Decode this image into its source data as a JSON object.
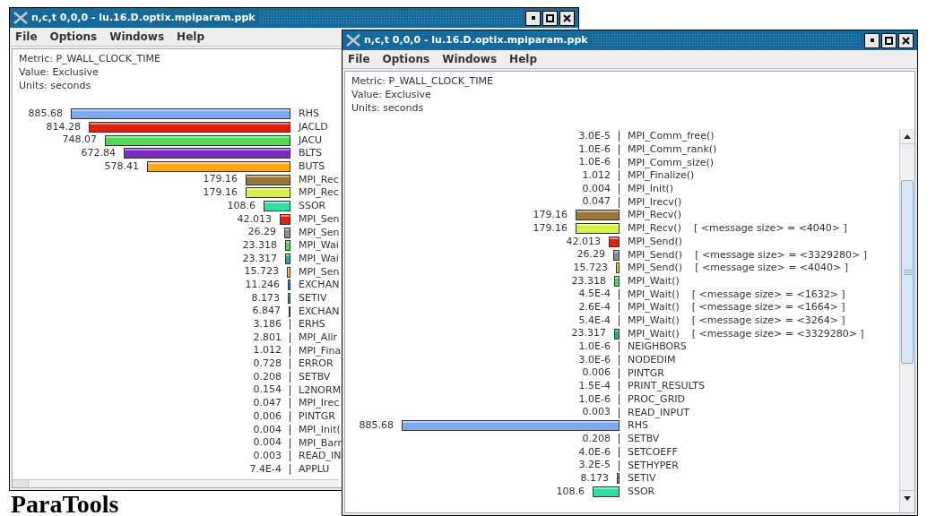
{
  "windows": [
    {
      "title": "n,c,t 0,0,0 - lu.16.D.optix.mpiparam.ppk",
      "menu": [
        "File",
        "Options",
        "Windows",
        "Help"
      ],
      "info": [
        "Metric: P_WALL_CLOCK_TIME",
        "Value: Exclusive",
        "Units: seconds"
      ],
      "rows": [
        {
          "value": "885.68",
          "label": "RHS",
          "color": "#7faaf2"
        },
        {
          "value": "814.28",
          "label": "JACLD",
          "color": "#e0200c"
        },
        {
          "value": "748.07",
          "label": "JACU",
          "color": "#52d852"
        },
        {
          "value": "672.84",
          "label": "BLTS",
          "color": "#7a2cc0"
        },
        {
          "value": "578.41",
          "label": "BUTS",
          "color": "#ffa812"
        },
        {
          "value": "179.16",
          "label": "MPI_Rec",
          "color": "#9a7638"
        },
        {
          "value": "179.16",
          "label": "MPI_Rec",
          "color": "#d6f248"
        },
        {
          "value": "108.6",
          "label": "SSOR",
          "color": "#2ee0a4"
        },
        {
          "value": "42.013",
          "label": "MPI_Sen",
          "color": "#e0200c"
        },
        {
          "value": "26.29",
          "label": "MPI_Sen",
          "color": "#8c8c8c"
        },
        {
          "value": "23.318",
          "label": "MPI_Wai",
          "color": "#52d852"
        },
        {
          "value": "23.317",
          "label": "MPI_Wai",
          "color": "#1fae96"
        },
        {
          "value": "15.723",
          "label": "MPI_Sen",
          "color": "#f2c21e"
        },
        {
          "value": "11.246",
          "label": "EXCHAN",
          "color": "#1f86e0"
        },
        {
          "value": "8.173",
          "label": "SETIV",
          "color": "#5e9e62"
        },
        {
          "value": "6.847",
          "label": "EXCHAN"
        },
        {
          "value": "3.186",
          "label": "ERHS"
        },
        {
          "value": "2.801",
          "label": "MPI_Allr"
        },
        {
          "value": "1.012",
          "label": "MPI_Fina"
        },
        {
          "value": "0.728",
          "label": "ERROR"
        },
        {
          "value": "0.208",
          "label": "SETBV"
        },
        {
          "value": "0.154",
          "label": "L2NORM"
        },
        {
          "value": "0.047",
          "label": "MPI_Irec"
        },
        {
          "value": "0.006",
          "label": "PINTGR"
        },
        {
          "value": "0.004",
          "label": "MPI_Init("
        },
        {
          "value": "0.004",
          "label": "MPI_Barr"
        },
        {
          "value": "0.003",
          "label": "READ_IN"
        },
        {
          "value": "7.4E-4",
          "label": "APPLU"
        }
      ]
    },
    {
      "title": "n,c,t 0,0,0 - lu.16.D.optix.mpiparam.ppk",
      "menu": [
        "File",
        "Options",
        "Windows",
        "Help"
      ],
      "info": [
        "Metric: P_WALL_CLOCK_TIME",
        "Value: Exclusive",
        "Units: seconds"
      ],
      "rows": [
        {
          "value": "3.0E-5",
          "label": "MPI_Comm_free()"
        },
        {
          "value": "1.0E-6",
          "label": "MPI_Comm_rank()"
        },
        {
          "value": "1.0E-6",
          "label": "MPI_Comm_size()"
        },
        {
          "value": "1.012",
          "label": "MPI_Finalize()"
        },
        {
          "value": "0.004",
          "label": "MPI_Init()"
        },
        {
          "value": "0.047",
          "label": "MPI_Irecv()"
        },
        {
          "value": "179.16",
          "label": "MPI_Recv()",
          "color": "#9a7638"
        },
        {
          "value": "179.16",
          "label": "MPI_Recv()",
          "detail": "[ <message size> = <4040> ]",
          "color": "#d6f248"
        },
        {
          "value": "42.013",
          "label": "MPI_Send()",
          "color": "#e0200c"
        },
        {
          "value": "26.29",
          "label": "MPI_Send()",
          "detail": "[ <message size> = <3329280> ]",
          "color": "#8c8c8c"
        },
        {
          "value": "15.723",
          "label": "MPI_Send()",
          "detail": "[ <message size> = <4040> ]",
          "color": "#f2c21e"
        },
        {
          "value": "23.318",
          "label": "MPI_Wait()",
          "color": "#52d852"
        },
        {
          "value": "4.5E-4",
          "label": "MPI_Wait()",
          "detail": "[ <message size> = <1632> ]"
        },
        {
          "value": "2.6E-4",
          "label": "MPI_Wait()",
          "detail": "[ <message size> = <1664> ]"
        },
        {
          "value": "5.4E-4",
          "label": "MPI_Wait()",
          "detail": "[ <message size> = <3264> ]"
        },
        {
          "value": "23.317",
          "label": "MPI_Wait()",
          "detail": "[ <message size> = <3329280> ]",
          "color": "#1fae96"
        },
        {
          "value": "1.0E-6",
          "label": "NEIGHBORS"
        },
        {
          "value": "3.0E-6",
          "label": "NODEDIM"
        },
        {
          "value": "0.006",
          "label": "PINTGR"
        },
        {
          "value": "1.5E-4",
          "label": "PRINT_RESULTS"
        },
        {
          "value": "1.0E-6",
          "label": "PROC_GRID"
        },
        {
          "value": "0.003",
          "label": "READ_INPUT"
        },
        {
          "value": "885.68",
          "label": "RHS",
          "color": "#7faaf2"
        },
        {
          "value": "0.208",
          "label": "SETBV"
        },
        {
          "value": "4.0E-6",
          "label": "SETCOEFF"
        },
        {
          "value": "3.2E-5",
          "label": "SETHYPER"
        },
        {
          "value": "8.173",
          "label": "SETIV",
          "color": "#5e9e62"
        },
        {
          "value": "108.6",
          "label": "SSOR",
          "color": "#2ee0a4"
        }
      ]
    }
  ],
  "logo": "ParaTools"
}
